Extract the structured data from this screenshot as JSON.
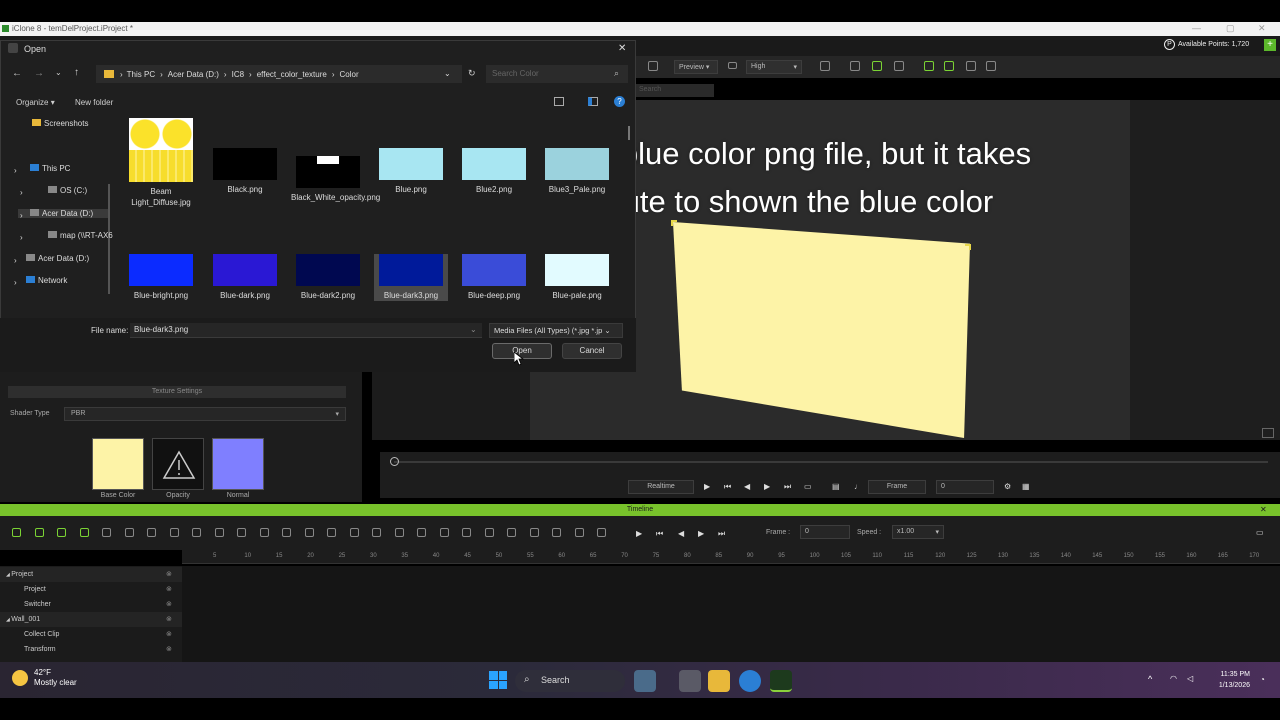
{
  "app": {
    "title": "iClone 8 - temDelProject.iProject *",
    "points_label": "Available Points: 1,720"
  },
  "toolbar": {
    "preview": "Preview",
    "quality": "High",
    "search_placeholder": "Search"
  },
  "caption": {
    "line1": "Apply a blue color png file, but it takes",
    "line2": "a minute to shown the blue color"
  },
  "dialog": {
    "title": "Open",
    "address": [
      "This PC",
      "Acer Data (D:)",
      "IC8",
      "effect_color_texture",
      "Color"
    ],
    "search_placeholder": "Search Color",
    "organize": "Organize",
    "new_folder": "New folder",
    "nav": [
      {
        "label": "Screenshots"
      },
      {
        "label": "This PC"
      },
      {
        "label": "OS (C:)"
      },
      {
        "label": "Acer Data (D:)"
      },
      {
        "label": "map (\\\\RT-AX6"
      },
      {
        "label": "Acer Data (D:)"
      },
      {
        "label": "Network"
      }
    ],
    "files": [
      {
        "name": "Beam Light_Diffuse.jpg",
        "color": "#f7dd2c"
      },
      {
        "name": "Black.png",
        "color": "#000000"
      },
      {
        "name": "Black_White_opacity.png",
        "color": "#000000"
      },
      {
        "name": "Blue.png",
        "color": "#a8e6f2"
      },
      {
        "name": "Blue2.png",
        "color": "#a8e6f2"
      },
      {
        "name": "Blue3_Pale.png",
        "color": "#a8e6f2"
      },
      {
        "name": "Blue-bright.png",
        "color": "#0b2bff"
      },
      {
        "name": "Blue-dark.png",
        "color": "#2a18d4"
      },
      {
        "name": "Blue-dark2.png",
        "color": "#000850"
      },
      {
        "name": "Blue-dark3.png",
        "color": "#001a9a"
      },
      {
        "name": "Blue-deep.png",
        "color": "#3a4cd8"
      },
      {
        "name": "Blue-pale.png",
        "color": "#e2fbff"
      }
    ],
    "file_name_label": "File name:",
    "file_name_value": "Blue-dark3.png",
    "file_type": "Media Files (All Types) (*.jpg *.jp",
    "open_label": "Open",
    "cancel_label": "Cancel"
  },
  "texture_panel": {
    "header": "Texture Settings",
    "shader_label": "Shader Type",
    "shader_value": "PBR",
    "slots": [
      {
        "label": "Base Color",
        "color": "#fdf3a7"
      },
      {
        "label": "Opacity",
        "color": "#ffffff"
      },
      {
        "label": "Normal",
        "color": "#7f7fff"
      }
    ]
  },
  "playbar": {
    "realtime": "Realtime",
    "frame_label": "Frame",
    "frame_value": "0"
  },
  "timeline": {
    "title": "Timeline",
    "frame_label": "Frame :",
    "frame_value": "0",
    "speed_label": "Speed :",
    "speed_value": "x1.00",
    "ruler": [
      "5",
      "10",
      "15",
      "20",
      "25",
      "30",
      "35",
      "40",
      "45",
      "50",
      "55",
      "60",
      "65",
      "70",
      "75",
      "80",
      "85",
      "90",
      "95",
      "100",
      "105",
      "110",
      "115",
      "120",
      "125",
      "130",
      "135",
      "140",
      "145",
      "150",
      "155",
      "160",
      "165",
      "170"
    ],
    "tracks": [
      {
        "label": "Project",
        "level": 0
      },
      {
        "label": "Project",
        "level": 1
      },
      {
        "label": "Switcher",
        "level": 1
      },
      {
        "label": "Wall_001",
        "level": 0
      },
      {
        "label": "Collect Clip",
        "level": 1
      },
      {
        "label": "Transform",
        "level": 1
      }
    ]
  },
  "taskbar": {
    "weather_temp": "42°F",
    "weather_desc": "Mostly clear",
    "search": "Search",
    "time": "11:35 PM",
    "date": "1/13/2026"
  }
}
